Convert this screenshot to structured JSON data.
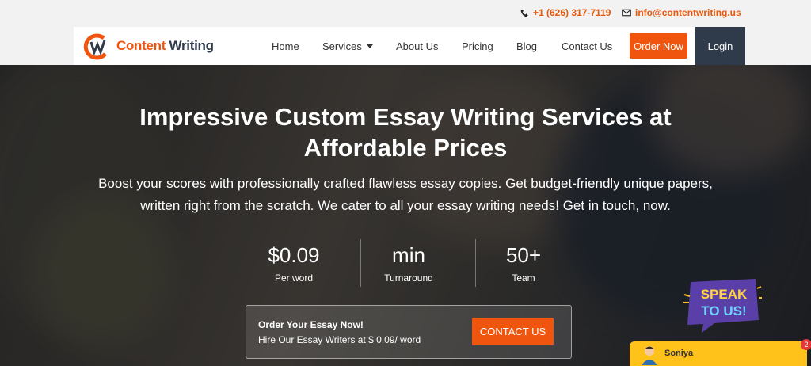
{
  "topbar": {
    "phone": "+1 (626) 317-7119",
    "email": "info@contentwriting.us"
  },
  "brand": {
    "word1": "Content",
    "word2": "Writing",
    "accent_color": "#f0550f",
    "dark_color": "#2f3a4a"
  },
  "nav": {
    "home": "Home",
    "services": "Services",
    "about": "About Us",
    "pricing": "Pricing",
    "blog": "Blog",
    "contact": "Contact Us",
    "order": "Order Now",
    "login": "Login"
  },
  "hero": {
    "headline_line1": "Impressive Custom Essay Writing Services at",
    "headline_line2": "Affordable Prices",
    "sub_line1": "Boost your scores with professionally crafted flawless essay copies. Get budget-friendly unique papers,",
    "sub_line2": "written right from the scratch. We cater to all your essay writing needs! Get in touch, now."
  },
  "stats": [
    {
      "value": "$0.09",
      "label": "Per word"
    },
    {
      "value": "min",
      "label": "Turnaround"
    },
    {
      "value": "50+",
      "label": "Team"
    }
  ],
  "cta": {
    "title": "Order Your Essay Now!",
    "text": "Hire Our Essay Writers at $ 0.09/ word",
    "button": "CONTACT US"
  },
  "speak_badge": {
    "line1": "SPEAK",
    "line2": "TO US!"
  },
  "chat": {
    "agent_name": "Soniya",
    "unread_count": "2"
  },
  "icons": {
    "phone": "phone-icon",
    "email": "envelope-icon",
    "dropdown": "caret-down-icon",
    "agent": "agent-avatar-icon"
  }
}
